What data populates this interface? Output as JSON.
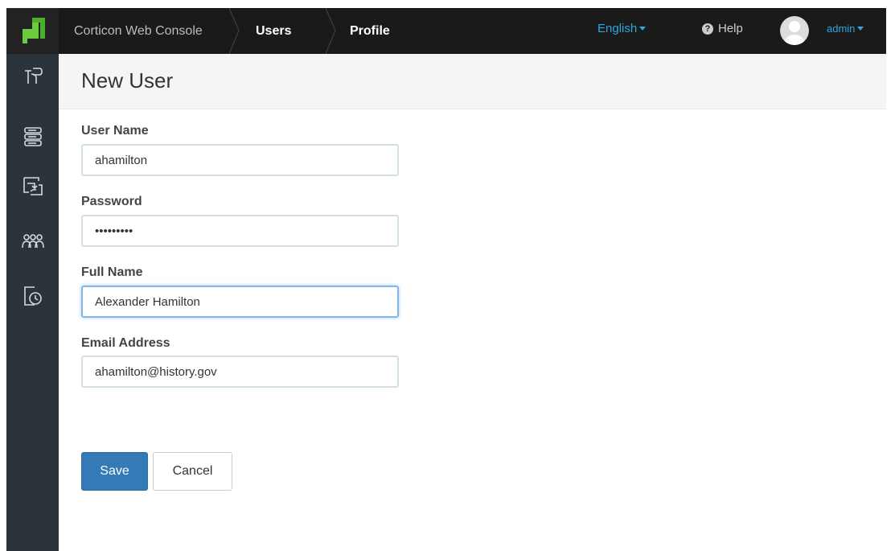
{
  "topbar": {
    "app_name": "Corticon Web Console",
    "crumb_users": "Users",
    "crumb_profile": "Profile",
    "language": "English",
    "help": "Help",
    "user": "admin"
  },
  "sidebar": {
    "icons": [
      "rules-icon",
      "servers-icon",
      "deployments-icon",
      "users-icon",
      "history-icon"
    ]
  },
  "page": {
    "title": "New User"
  },
  "form": {
    "username_label": "User Name",
    "username_value": "ahamilton",
    "password_label": "Password",
    "password_value": "ahamilton",
    "fullname_label": "Full Name",
    "fullname_value": "Alexander Hamilton",
    "email_label": "Email Address",
    "email_value": "ahamilton@history.gov"
  },
  "buttons": {
    "save": "Save",
    "cancel": "Cancel"
  },
  "colors": {
    "topbar": "#1a1a1a",
    "sidebar": "#2b333b",
    "accent": "#2aa8e0",
    "logo_green": "#6dc93e",
    "primary_button": "#337ab7"
  }
}
